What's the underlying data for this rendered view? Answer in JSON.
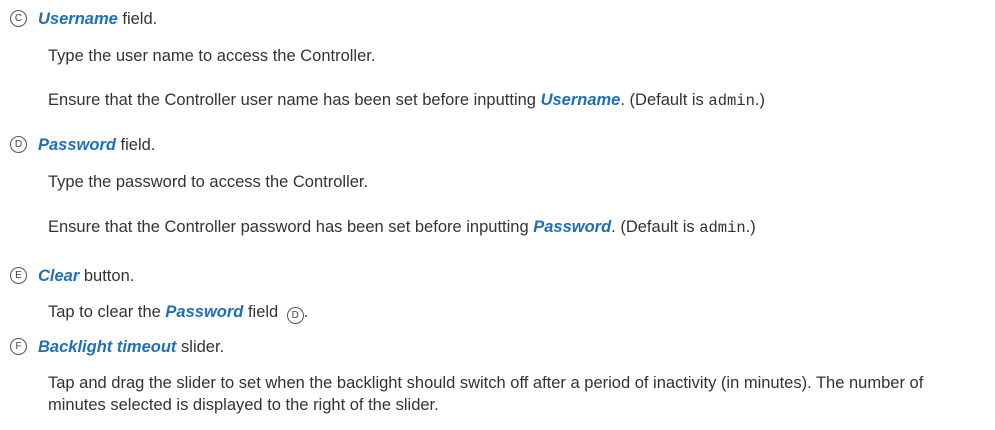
{
  "items": [
    {
      "marker": "C",
      "term": "Username",
      "suffix": " field.",
      "desc": "Type the user name to access the Controller.",
      "note": {
        "before": "Ensure that the Controller user name has been set before inputting ",
        "term": "Username",
        "middle": ". (Default is ",
        "code": "admin",
        "after": ".)"
      }
    },
    {
      "marker": "D",
      "term": "Password",
      "suffix": " field.",
      "desc": "Type the password to access the Controller.",
      "note": {
        "before": "Ensure that the Controller password has been set before inputting ",
        "term": "Password",
        "middle": ". (Default is ",
        "code": "admin",
        "after": ".)"
      }
    },
    {
      "marker": "E",
      "term": "Clear",
      "suffix": " button.",
      "desc": {
        "before": "Tap to clear the ",
        "term": "Password",
        "after": " field ",
        "ref": "D",
        "end": "."
      }
    },
    {
      "marker": "F",
      "term": "Backlight timeout",
      "suffix": " slider.",
      "desc": "Tap and drag the slider to set when the backlight should switch off after a period of inactivity (in minutes). The number of minutes selected is displayed to the right of the slider."
    }
  ]
}
